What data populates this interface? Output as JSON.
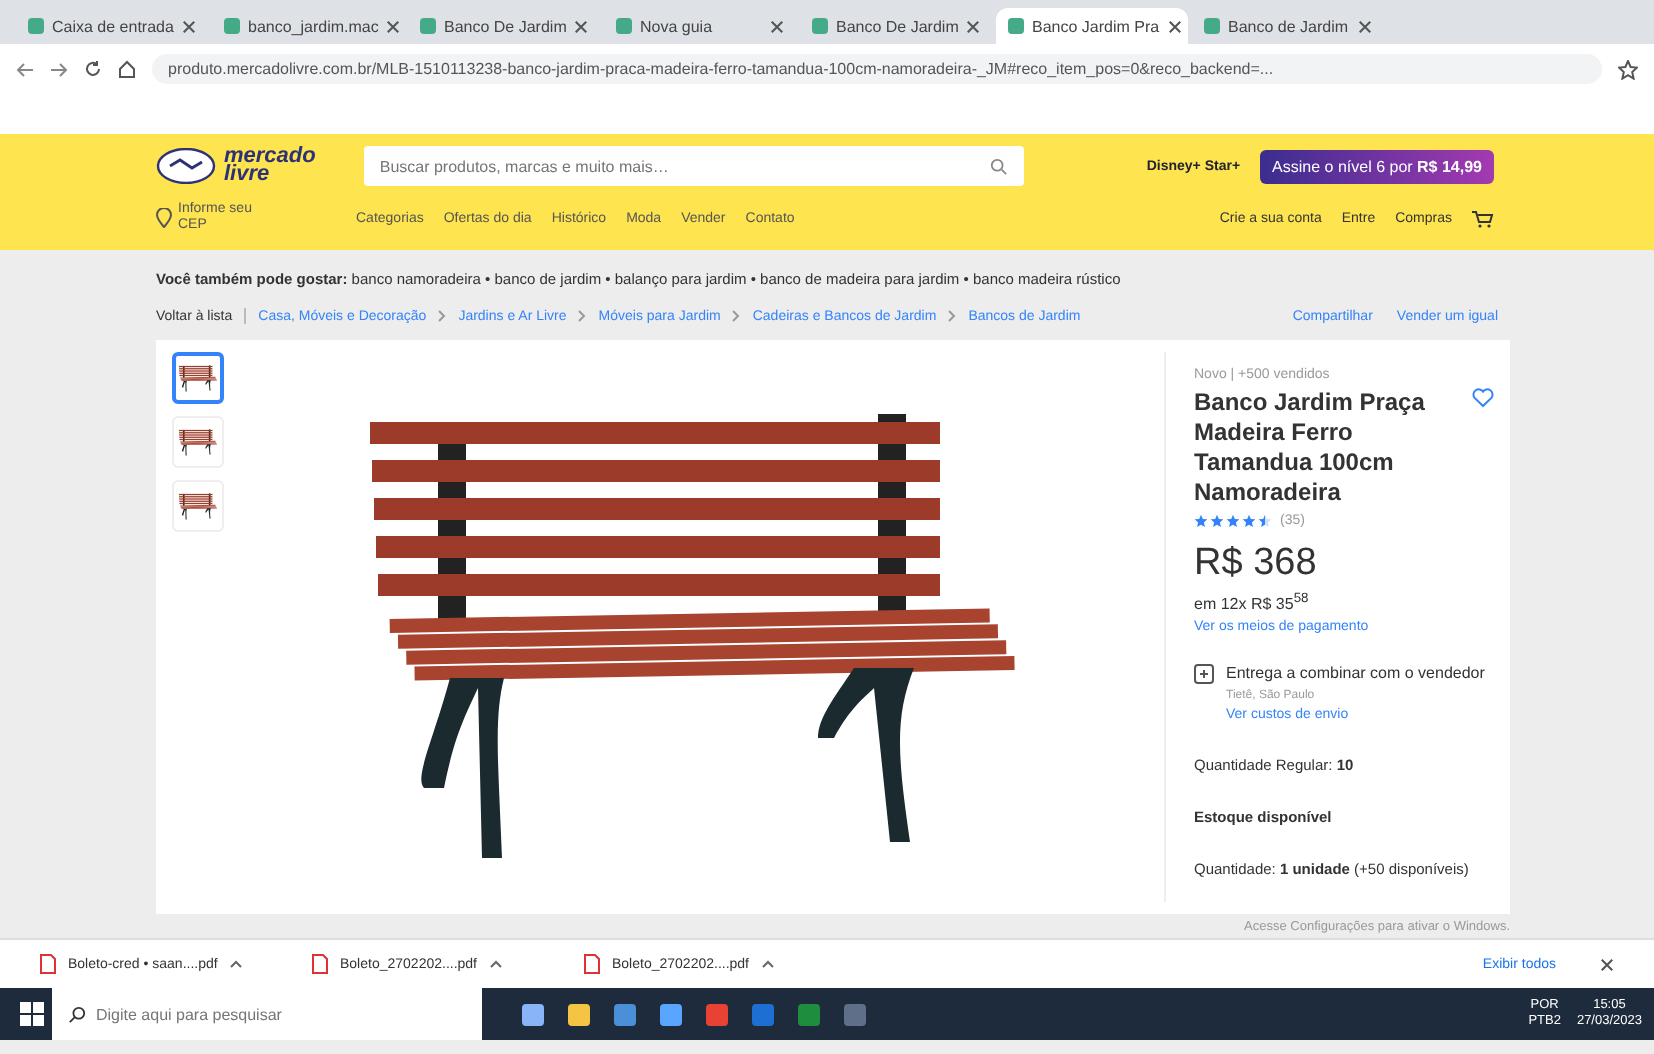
{
  "tabs": [
    {
      "label": "Caixa de entrada",
      "selected": false
    },
    {
      "label": "banco_jardim.mac",
      "selected": false
    },
    {
      "label": "Banco De Jardim",
      "selected": false
    },
    {
      "label": "Nova guia",
      "selected": false
    },
    {
      "label": "Banco De Jardim",
      "selected": false
    },
    {
      "label": "Banco Jardim Pra",
      "selected": true
    },
    {
      "label": "Banco de Jardim",
      "selected": false
    }
  ],
  "address_bar": {
    "url": "produto.mercadolivre.com.br/MLB-1510113238-banco-jardim-praca-madeira-ferro-tamandua-100cm-namoradeira-_JM#reco_item_pos=0&reco_backend=..."
  },
  "header": {
    "logo": [
      "mercado",
      "livre"
    ],
    "search": {
      "placeholder": "Buscar produtos, marcas e muito mais…"
    },
    "streaming": "Disney+ Star+",
    "promo": "Assine o nível 6 por **R$ 14,99**",
    "location": [
      "Informe seu",
      "CEP"
    ],
    "nav": [
      "Categorias",
      "Ofertas do dia",
      "Histórico",
      "Moda",
      "Vender",
      "Contato"
    ],
    "account": [
      "Crie a sua conta",
      "Entre",
      "Compras"
    ]
  },
  "suggestions": "**Você também pode gostar:** banco namoradeira • banco de jardim • balanço para jardim • banco de madeira para jardim • banco madeira rústico",
  "breadcrumb": {
    "back": "Voltar à lista",
    "items": [
      "Casa, Móveis e Decoração",
      "Jardins e Ar Livre",
      "Móveis para Jardim",
      "Cadeiras e Bancos de Jardim",
      "Bancos de Jardim"
    ],
    "actions": [
      "Compartilhar",
      "Vender um igual"
    ]
  },
  "gallery": [
    {
      "selected": true
    },
    {
      "selected": false
    },
    {
      "selected": false
    }
  ],
  "product": {
    "condition": "Novo | +500 vendidos",
    "title": "Banco Jardim Praça Madeira Ferro Tamandua 100cm Namoradeira",
    "stars": 4.5,
    "reviews": "(35)",
    "price": "R$ 368",
    "installments": "em 12x R$ 35$^{58}$",
    "payment_link": "Ver os meios de pagamento",
    "delivery": "Entrega a combinar com o vendedor",
    "location": "Tietê, São Paulo",
    "shipping_link": "Ver custos de envio",
    "quantity_rule": "Quantidade Regular: **10**",
    "stock": "Estoque disponível",
    "quantity": "Quantidade: **1 unidade** (+50 disponíveis)"
  },
  "windows_notice": "Acesse Configurações para ativar o Windows.",
  "downloads": {
    "files": [
      "Boleto-cred • saan....pdf",
      "Boleto_2702202....pdf",
      "Boleto_2702202....pdf"
    ],
    "show_all": "Exibir todos"
  },
  "taskbar": {
    "search": {
      "placeholder": "Digite aqui para pesquisar"
    },
    "language": [
      "POR",
      "PTB2"
    ],
    "time": "15:05",
    "date": "27/03/2023"
  }
}
